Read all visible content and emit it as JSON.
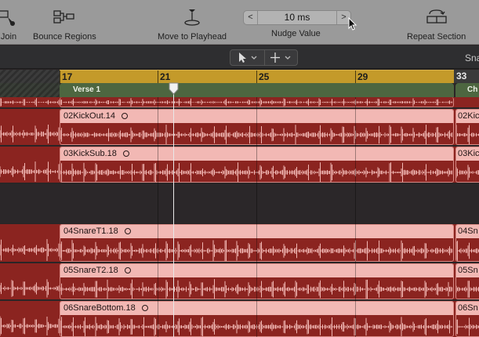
{
  "toolbar": {
    "join_label": "Join",
    "bounce_label": "Bounce Regions",
    "move_label": "Move to Playhead",
    "nudge_label": "Nudge Value",
    "nudge_value": "10 ms",
    "nudge_left": "<",
    "nudge_right": ">",
    "repeat_label": "Repeat Section"
  },
  "subbar": {
    "partial_label": "Sna"
  },
  "ruler": {
    "bars": [
      "17",
      "21",
      "25",
      "29",
      "33"
    ]
  },
  "arrangement": {
    "verse_label": "Verse 1",
    "next_label": "Ch"
  },
  "tracks": [
    {
      "region": "",
      "right_label": ""
    },
    {
      "region": "02KickOut.14",
      "right_label": "02Kic"
    },
    {
      "region": "03KickSub.18",
      "right_label": "03Kick"
    },
    {
      "region": "",
      "right_label": ""
    },
    {
      "region": "04SnareT1.18",
      "right_label": "04Sn"
    },
    {
      "region": "05SnareT2.18",
      "right_label": "05Sn"
    },
    {
      "region": "06SnareBottom.18",
      "right_label": "06Sn"
    }
  ],
  "colors": {
    "region_body": "#8b2420",
    "region_header": "#f2b8b4",
    "ruler": "#c49a2a",
    "arrangement": "#4d6640"
  }
}
